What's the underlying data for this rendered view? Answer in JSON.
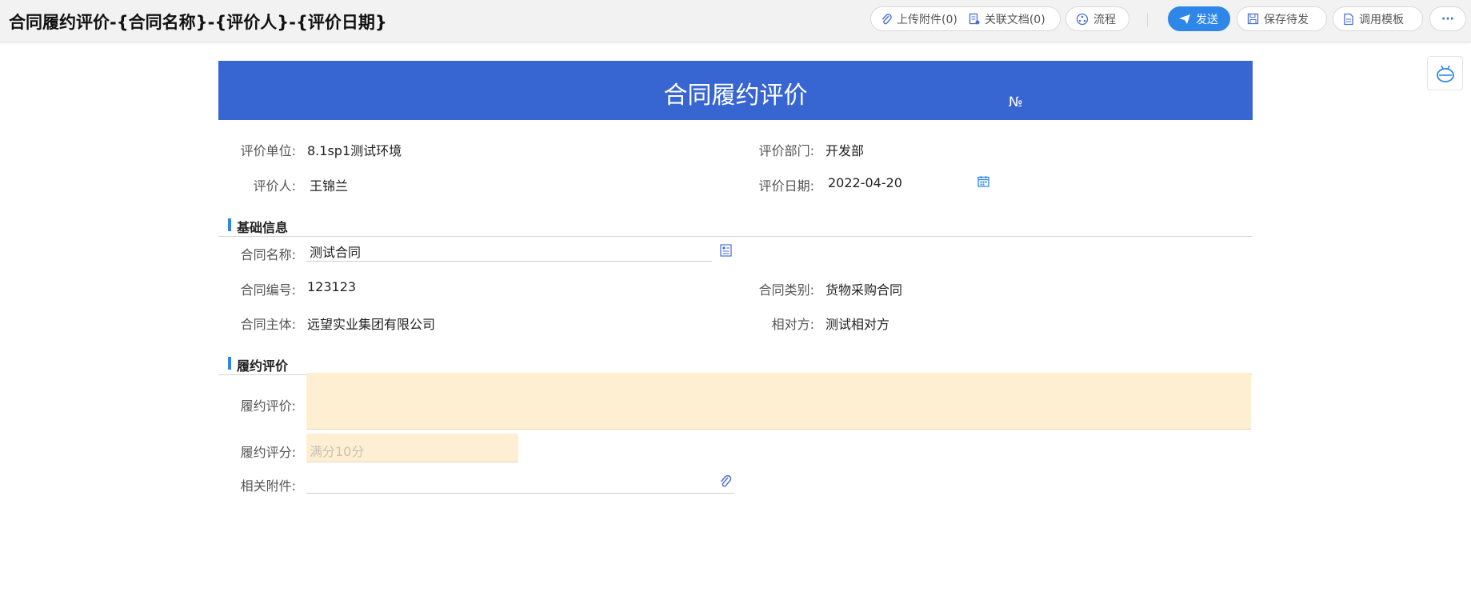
{
  "header": {
    "title": "合同履约评价-{合同名称}-{评价人}-{评价日期}",
    "buttons": {
      "upload": "上传附件(0)",
      "related": "关联文档(0)",
      "flow": "流程",
      "send": "发送",
      "save": "保存待发",
      "template": "调用模板",
      "more": "···"
    }
  },
  "form": {
    "title": "合同履约评价",
    "number_mark": "№",
    "top_fields": {
      "unit_label": "评价单位:",
      "unit_value": "8.1sp1测试环境",
      "dept_label": "评价部门:",
      "dept_value": "开发部",
      "person_label": "评价人:",
      "person_value": "王锦兰",
      "date_label": "评价日期:",
      "date_value": "2022-04-20"
    },
    "basic": {
      "section_title": "基础信息",
      "contract_name_label": "合同名称:",
      "contract_name_value": "测试合同",
      "contract_no_label": "合同编号:",
      "contract_no_value": "123123",
      "contract_type_label": "合同类别:",
      "contract_type_value": "货物采购合同",
      "subject_label": "合同主体:",
      "subject_value": "远望实业集团有限公司",
      "counterpart_label": "相对方:",
      "counterpart_value": "测试相对方"
    },
    "evaluation": {
      "section_title": "履约评价",
      "eval_label": "履约评价:",
      "eval_value": "",
      "score_label": "履约评分:",
      "score_placeholder": "满分10分",
      "attachment_label": "相关附件:"
    }
  },
  "colors": {
    "header_blue": "#3765d1",
    "accent_blue": "#2e86e8",
    "input_fill": "#ffefd2"
  }
}
